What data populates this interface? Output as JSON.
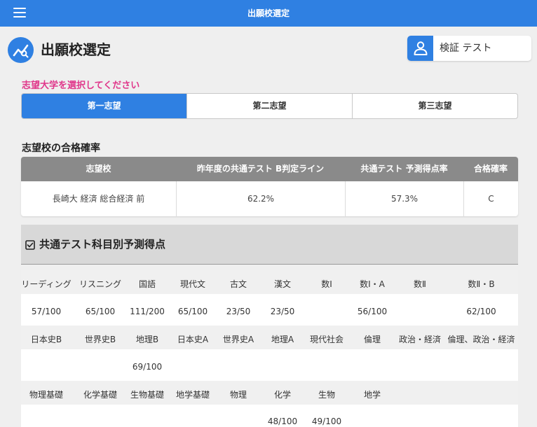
{
  "topbar": {
    "title": "出願校選定",
    "menu_icon": "hamburger-menu-icon"
  },
  "page": {
    "title": "出願校選定",
    "icon": "chart-line-icon"
  },
  "user": {
    "name": "検証 テスト",
    "icon": "user-icon"
  },
  "colors": {
    "primary": "#2f80e2",
    "prompt": "#e0368a",
    "table_header": "#8a8a8a",
    "panel": "#d8d8d8"
  },
  "choices": {
    "prompt": "志望大学を選択してください",
    "tabs": [
      {
        "label": "第一志望",
        "active": true
      },
      {
        "label": "第二志望",
        "active": false
      },
      {
        "label": "第三志望",
        "active": false
      }
    ]
  },
  "probability": {
    "heading": "志望校の合格確率",
    "columns": [
      "志望校",
      "昨年度の共通テスト B判定ライン",
      "共通テスト 予測得点率",
      "合格確率"
    ],
    "row": [
      "長崎大 経済 総合経済 前",
      "62.2%",
      "57.3%",
      "C"
    ]
  },
  "subjects": {
    "heading": "共通テスト科目別予測得点",
    "icon": "checkbox-icon",
    "rows": [
      {
        "headers": [
          "リーディング",
          "リスニング",
          "国語",
          "現代文",
          "古文",
          "漢文",
          "数Ⅰ",
          "数Ⅰ・A",
          "数Ⅱ",
          "数Ⅱ・B"
        ],
        "values": [
          "57/100",
          "65/100",
          "111/200",
          "65/100",
          "23/50",
          "23/50",
          "",
          "56/100",
          "",
          "62/100"
        ]
      },
      {
        "headers": [
          "日本史B",
          "世界史B",
          "地理B",
          "日本史A",
          "世界史A",
          "地理A",
          "現代社会",
          "倫理",
          "政治・経済",
          "倫理、政治・経済"
        ],
        "values": [
          "",
          "",
          "69/100",
          "",
          "",
          "",
          "",
          "",
          "",
          ""
        ]
      },
      {
        "headers": [
          "物理基礎",
          "化学基礎",
          "生物基礎",
          "地学基礎",
          "物理",
          "化学",
          "生物",
          "地学",
          "",
          ""
        ],
        "values": [
          "",
          "",
          "",
          "",
          "",
          "48/100",
          "49/100",
          "",
          "",
          ""
        ]
      }
    ]
  }
}
